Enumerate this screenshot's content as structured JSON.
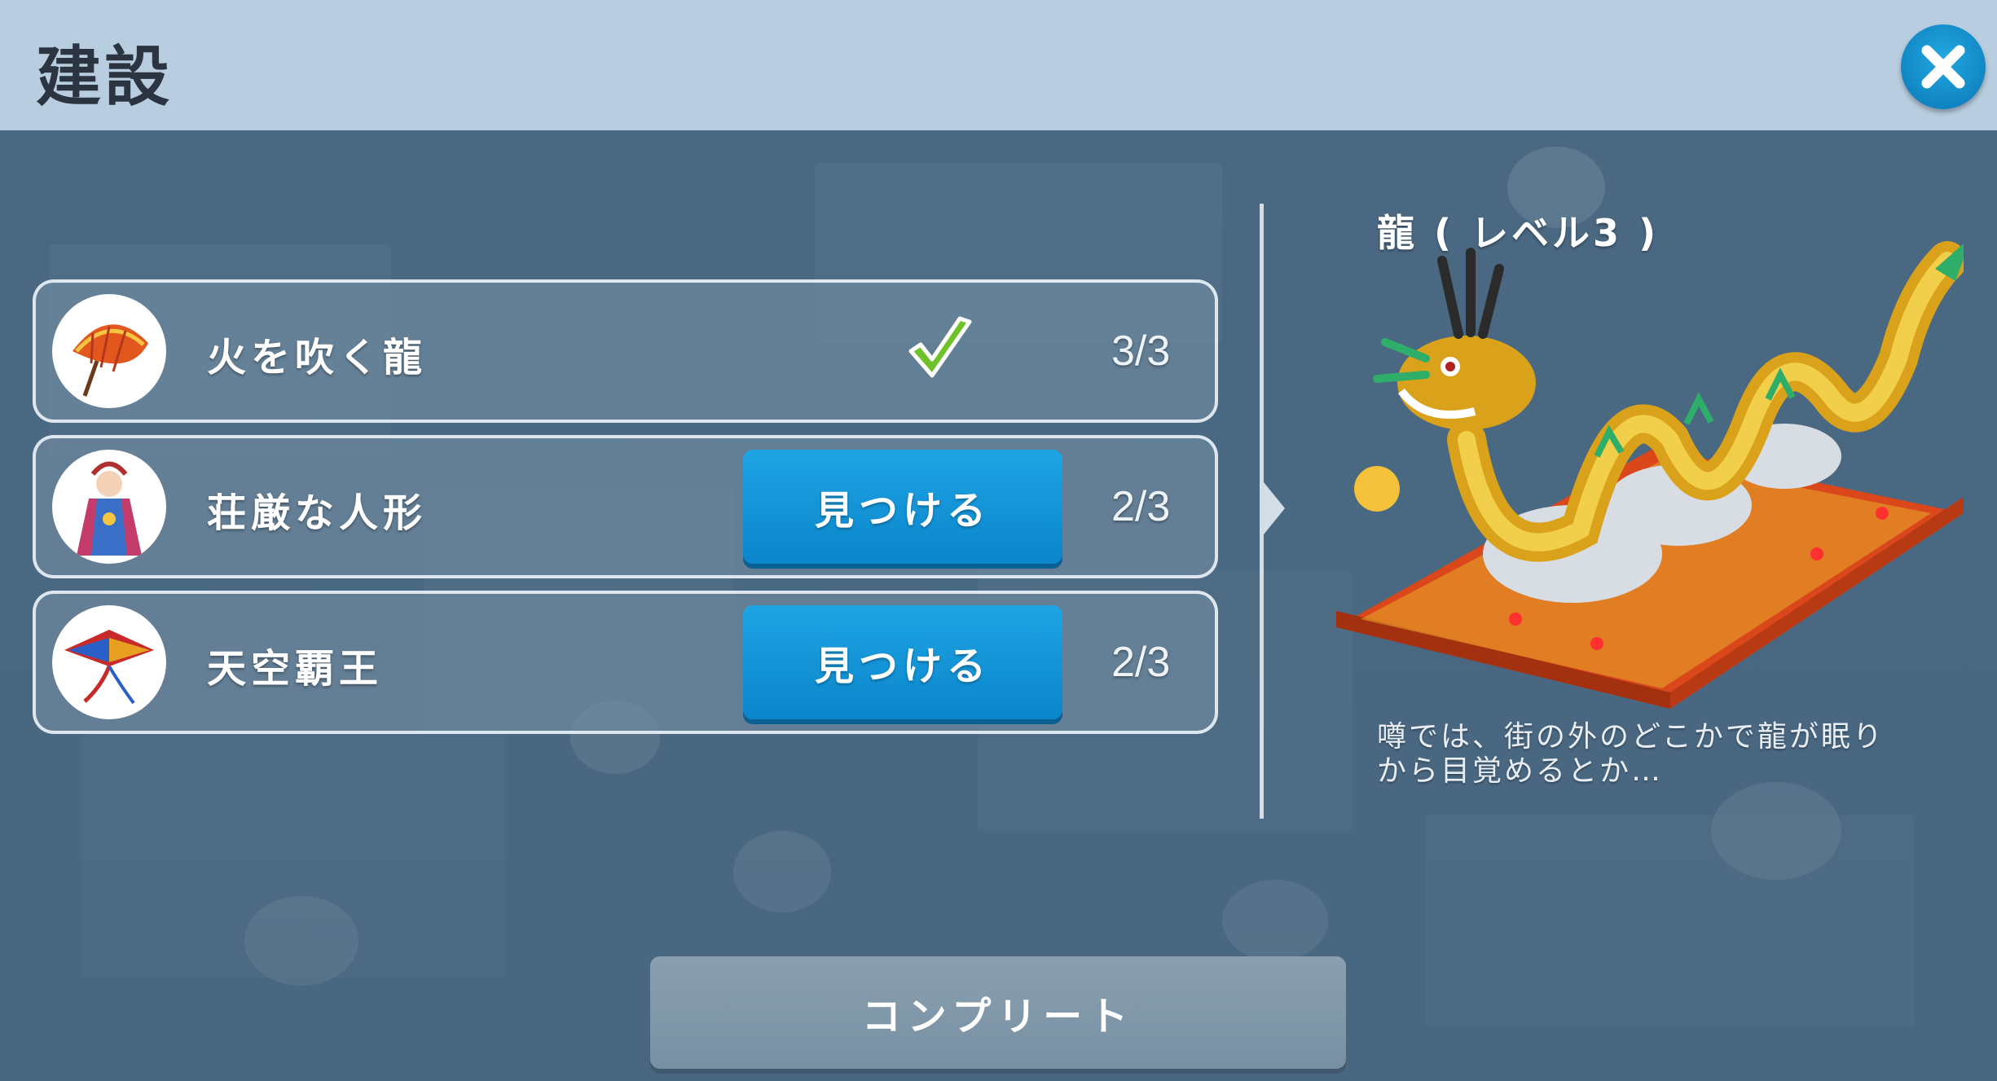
{
  "header": {
    "title": "建設",
    "close_icon": "close-icon"
  },
  "requirements": [
    {
      "name": "火を吹く龍",
      "icon": "paper-umbrella-icon",
      "count": "3/3",
      "complete": true
    },
    {
      "name": "荘厳な人形",
      "icon": "doll-icon",
      "count": "2/3",
      "complete": false,
      "action_label": "見つける"
    },
    {
      "name": "天空覇王",
      "icon": "kite-icon",
      "count": "2/3",
      "complete": false,
      "action_label": "見つける"
    }
  ],
  "building": {
    "name": "龍 ( レベル3 )",
    "image": "dragon-building-icon",
    "description": "噂では、街の外のどこかで龍が眠りから目覚めるとか…"
  },
  "complete_label": "コンプリート",
  "colors": {
    "header_bg": "#b8cde0",
    "button_blue": "#0b85cb",
    "complete_gray": "#8aa0b1",
    "check_green": "#6fc22a"
  }
}
